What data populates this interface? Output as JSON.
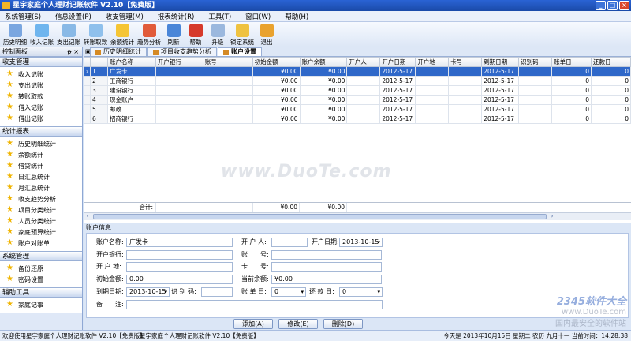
{
  "app": {
    "title": "星宇家庭个人理财记账软件 V2.10【免费版】",
    "window_controls": [
      "_",
      "□",
      "×"
    ]
  },
  "menu": [
    "系统管理(S)",
    "信息设置(P)",
    "收支管理(M)",
    "报表统计(R)",
    "工具(T)",
    "窗口(W)",
    "帮助(H)"
  ],
  "toolbar": [
    {
      "label": "历史明细",
      "icon": "history-icon",
      "color": "#7aa6e0"
    },
    {
      "label": "收入记账",
      "icon": "income-icon",
      "color": "#6fb5ee"
    },
    {
      "label": "支出记账",
      "icon": "expense-icon",
      "color": "#89b9e6"
    },
    {
      "label": "转账取款",
      "icon": "transfer-icon",
      "color": "#8fc0ec"
    },
    {
      "label": "余额统计",
      "icon": "star-icon",
      "color": "#f5c535"
    },
    {
      "label": "趋势分析",
      "icon": "trend-icon",
      "color": "#e15b3a"
    },
    {
      "label": "刷新",
      "icon": "refresh-icon",
      "color": "#4a86d8"
    },
    {
      "label": "帮助",
      "icon": "help-icon",
      "color": "#d63a2b"
    },
    {
      "label": "升级",
      "icon": "upgrade-icon",
      "color": "#9bb8de"
    },
    {
      "label": "锁定系统",
      "icon": "lock-icon",
      "color": "#efc240"
    },
    {
      "label": "退出",
      "icon": "exit-icon",
      "color": "#e9a22e"
    }
  ],
  "sidebar": {
    "header": "控制面板",
    "pin": "ᵽ ×",
    "groups": [
      {
        "title": "收支管理",
        "items": [
          "收入记账",
          "支出记账",
          "转账取款",
          "借入记账",
          "借出记账"
        ]
      },
      {
        "title": "统计报表",
        "items": [
          "历史明细统计",
          "余额统计",
          "借贷统计",
          "日汇总统计",
          "月汇总统计",
          "收支趋势分析",
          "项目分类统计",
          "人员分类统计",
          "家庭预算统计",
          "账户对账单"
        ]
      },
      {
        "title": "系统管理",
        "items": [
          "备份还原",
          "密码设置"
        ]
      },
      {
        "title": "辅助工具",
        "items": [
          "家庭记事"
        ]
      }
    ]
  },
  "tabs": [
    {
      "label": "历史明细统计",
      "active": false
    },
    {
      "label": "项目收支趋势分析",
      "active": false
    },
    {
      "label": "账户设置",
      "active": true
    }
  ],
  "grid": {
    "columns": [
      "",
      "",
      "账户名称",
      "开户银行",
      "账号",
      "初始金额",
      "账户余额",
      "开户人",
      "开户日期",
      "开户地",
      "卡号",
      "到期日期",
      "识别码",
      "账单日",
      "还款日"
    ],
    "rows": [
      {
        "marker": "›",
        "no": "1",
        "name": "广发卡",
        "bank": "",
        "acct": "",
        "init": "¥0.00",
        "balance": "¥0.00",
        "owner": "",
        "open_date": "2012-5-17",
        "place": "",
        "card": "",
        "due": "2012-5-17",
        "code": "",
        "bill_day": "0",
        "pay_day": "0"
      },
      {
        "marker": "",
        "no": "2",
        "name": "工商银行",
        "bank": "",
        "acct": "",
        "init": "¥0.00",
        "balance": "¥0.00",
        "owner": "",
        "open_date": "2012-5-17",
        "place": "",
        "card": "",
        "due": "2012-5-17",
        "code": "",
        "bill_day": "0",
        "pay_day": "0"
      },
      {
        "marker": "",
        "no": "3",
        "name": "建设银行",
        "bank": "",
        "acct": "",
        "init": "¥0.00",
        "balance": "¥0.00",
        "owner": "",
        "open_date": "2012-5-17",
        "place": "",
        "card": "",
        "due": "2012-5-17",
        "code": "",
        "bill_day": "0",
        "pay_day": "0"
      },
      {
        "marker": "",
        "no": "4",
        "name": "现金账户",
        "bank": "",
        "acct": "",
        "init": "¥0.00",
        "balance": "¥0.00",
        "owner": "",
        "open_date": "2012-5-17",
        "place": "",
        "card": "",
        "due": "2012-5-17",
        "code": "",
        "bill_day": "0",
        "pay_day": "0"
      },
      {
        "marker": "",
        "no": "5",
        "name": "邮政",
        "bank": "",
        "acct": "",
        "init": "¥0.00",
        "balance": "¥0.00",
        "owner": "",
        "open_date": "2012-5-17",
        "place": "",
        "card": "",
        "due": "2012-5-17",
        "code": "",
        "bill_day": "0",
        "pay_day": "0"
      },
      {
        "marker": "",
        "no": "6",
        "name": "招商银行",
        "bank": "",
        "acct": "",
        "init": "¥0.00",
        "balance": "¥0.00",
        "owner": "",
        "open_date": "2012-5-17",
        "place": "",
        "card": "",
        "due": "2012-5-17",
        "code": "",
        "bill_day": "0",
        "pay_day": "0"
      }
    ],
    "total_label": "合计:",
    "total_init": "¥0.00",
    "total_balance": "¥0.00",
    "scroll_left": "‹",
    "scroll_right": "›"
  },
  "form": {
    "title": "账户信息",
    "labels": {
      "name": "账户名称:",
      "owner": "开 户 人:",
      "open_date": "开户日期:",
      "bank": "开户银行:",
      "acct": "账　　号:",
      "place": "开 户 地:",
      "card": "卡　　号:",
      "init": "初始金额:",
      "balance": "当前余额:",
      "due": "到期日期:",
      "code": "识 别 码:",
      "bill_day": "账 单 日:",
      "pay_day": "还 款 日:",
      "note": "备　　注:"
    },
    "values": {
      "name": "广发卡",
      "owner": "",
      "open_date": "2013-10-15",
      "bank": "",
      "acct": "",
      "place": "",
      "card": "",
      "init": "0.00",
      "balance": "¥0.00",
      "due": "2013-10-15",
      "code": "",
      "bill_day": "0",
      "pay_day": "0",
      "note": ""
    },
    "dropdown_arrow": "▾",
    "buttons": {
      "add": "添加(A)",
      "edit": "修改(E)",
      "delete": "删除(D)"
    }
  },
  "status": {
    "left1": "欢迎使用星宇家庭个人理财记账软件 V2.10【免费版】",
    "left2": "星宇家庭个人理财记账软件 V2.10【免费版】",
    "right": "今天是 2013年10月15日 星期二 农历 九月十一 当前时间：14:28:38"
  },
  "watermarks": {
    "center": "www.DuoTe.com",
    "corner_logo": "2345软件大全",
    "corner_sub": "国内最安全的软件站",
    "corner_url": "www.DuoTe.com"
  }
}
